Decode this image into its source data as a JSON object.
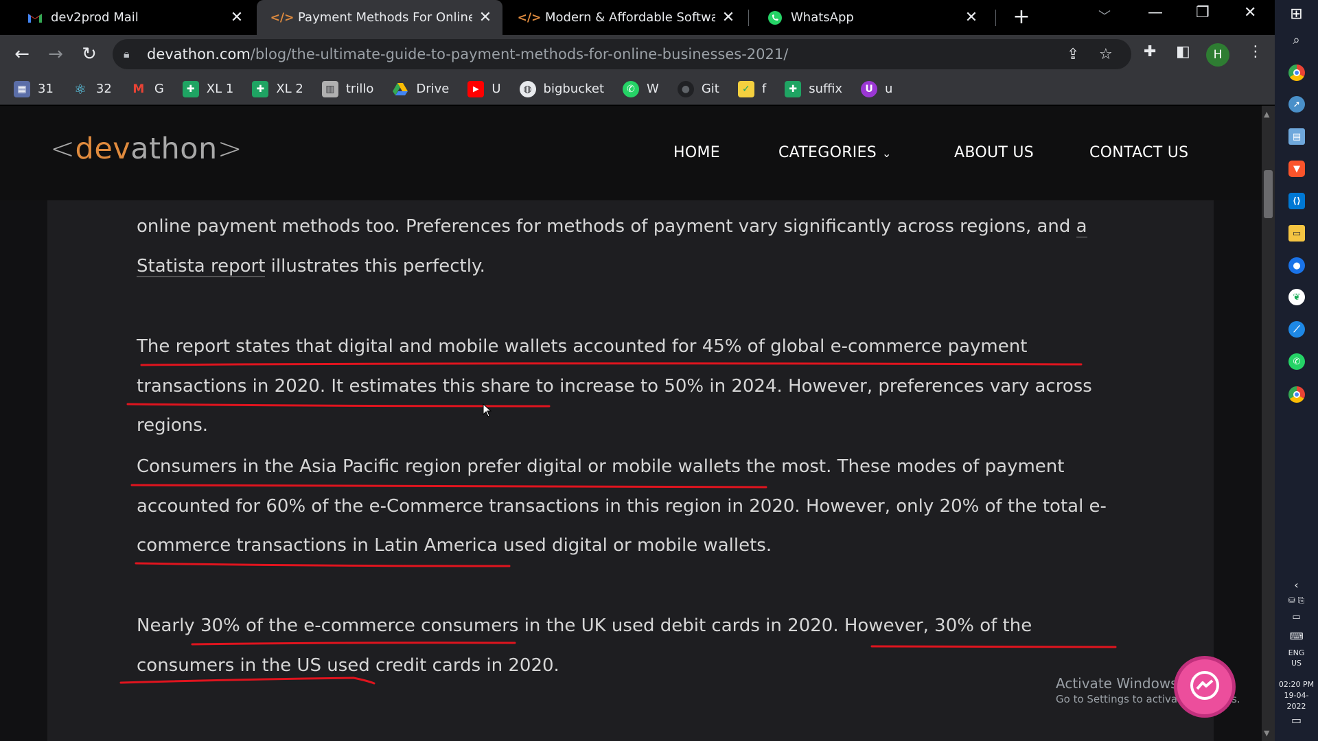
{
  "tabs": [
    {
      "title": "dev2prod Mail",
      "favicon": "gmail-icon",
      "active": false
    },
    {
      "title": "Payment Methods For Online Bu",
      "favicon": "code-icon",
      "active": true
    },
    {
      "title": "Modern & Affordable Software D",
      "favicon": "code-icon",
      "active": false
    },
    {
      "title": "WhatsApp",
      "favicon": "whatsapp-icon",
      "active": false
    }
  ],
  "address": {
    "domain": "devathon.com",
    "path": "/blog/the-ultimate-guide-to-payment-methods-for-online-businesses-2021/"
  },
  "profile_initial": "H",
  "bookmarks": [
    {
      "label": "31",
      "icon": "bookmark-icon",
      "color": "#5b6ea8"
    },
    {
      "label": "32",
      "icon": "react-icon",
      "color": "#1f2a3a"
    },
    {
      "label": "G",
      "icon": "gmail-icon",
      "color": "#ffffff"
    },
    {
      "label": "XL 1",
      "icon": "sheets-icon",
      "color": "#1fa463"
    },
    {
      "label": "XL 2",
      "icon": "sheets-icon",
      "color": "#1fa463"
    },
    {
      "label": "trillo",
      "icon": "trello-icon",
      "color": "#b0b0b0"
    },
    {
      "label": "Drive",
      "icon": "drive-icon",
      "color": "#fbbc04"
    },
    {
      "label": "U",
      "icon": "youtube-icon",
      "color": "#ff0000"
    },
    {
      "label": "bigbucket",
      "icon": "globe-icon",
      "color": "#e8eaed"
    },
    {
      "label": "W",
      "icon": "whatsapp-icon",
      "color": "#25d366"
    },
    {
      "label": "Git",
      "icon": "github-icon",
      "color": "#202124"
    },
    {
      "label": "f",
      "icon": "sticky-note-icon",
      "color": "#f4d03f"
    },
    {
      "label": "suffix",
      "icon": "sheets-icon",
      "color": "#1fa463"
    },
    {
      "label": "u",
      "icon": "u-icon",
      "color": "#9b37d4"
    }
  ],
  "site": {
    "logo_open": "<",
    "logo_dev": "dev",
    "logo_athon": "athon",
    "logo_close": ">",
    "nav": {
      "home": "HOME",
      "categories": "CATEGORIES",
      "about": "ABOUT US",
      "contact": "CONTACT US"
    }
  },
  "article": {
    "p1_a": "online payment methods too. Preferences for methods of payment vary significantly across regions, and ",
    "p1_link": "a Statista report",
    "p1_b": " illustrates this perfectly.",
    "p2": "The report states that digital and mobile wallets accounted for 45% of global e-commerce payment transactions in 2020. It estimates this share to increase to 50% in 2024. However, preferences vary across regions.",
    "p3": "Consumers in the Asia Pacific region prefer digital or mobile wallets the most. These modes of payment accounted for 60% of the e-Commerce transactions in this region in 2020. However, only 20% of the total e-commerce transactions in Latin America used digital or mobile wallets.",
    "p4": "Nearly 30% of the e-commerce consumers in the UK used debit cards in 2020. However, 30% of the consumers in the US used credit cards in 2020."
  },
  "watermark": {
    "line1": "Activate Windows",
    "line2": "Go to Settings to activate Windows."
  },
  "taskbar": {
    "lang": "ENG",
    "region": "US",
    "time": "02:20 PM",
    "date": "19-04-2022"
  },
  "colors": {
    "accent_orange": "#e08b3e",
    "annotation_red": "#e0141e"
  }
}
